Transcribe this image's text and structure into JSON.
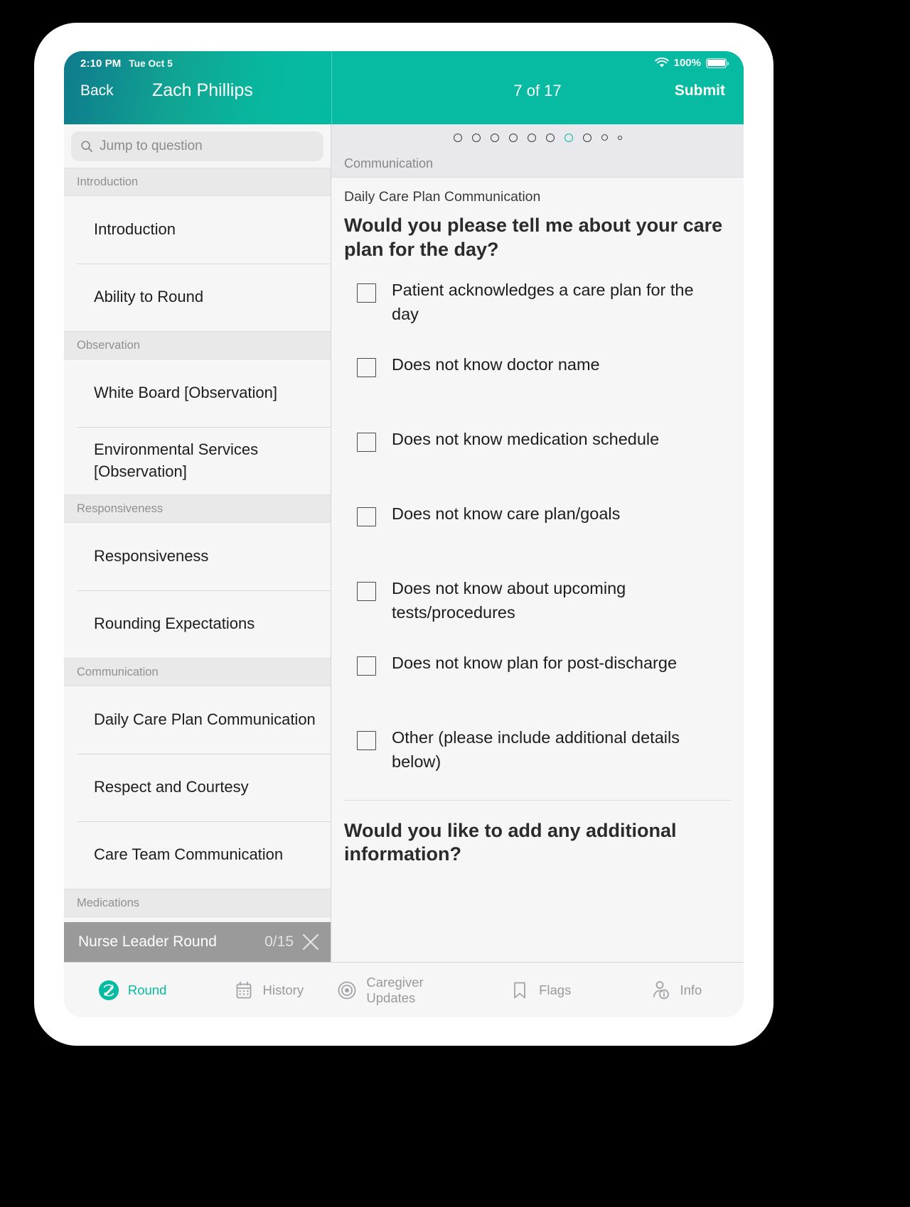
{
  "status_bar": {
    "time": "2:10 PM",
    "date": "Tue Oct 5",
    "wifi_icon": "wifi-icon",
    "battery_percent": "100%",
    "battery_icon": "battery-icon"
  },
  "nav": {
    "back_label": "Back",
    "patient_name": "Zach Phillips",
    "page_counter": "7 of 17",
    "submit_label": "Submit",
    "accent_color": "#06bba1"
  },
  "sidebar": {
    "search": {
      "placeholder": "Jump to question",
      "icon": "search-icon"
    },
    "sections": [
      {
        "header": "Introduction",
        "items": [
          "Introduction",
          "Ability to Round"
        ]
      },
      {
        "header": "Observation",
        "items": [
          "White Board [Observation]",
          "Environmental Services [Observation]"
        ]
      },
      {
        "header": "Responsiveness",
        "items": [
          "Responsiveness",
          "Rounding Expectations"
        ]
      },
      {
        "header": "Communication",
        "items": [
          "Daily Care Plan Communication",
          "Respect and Courtesy",
          "Care Team Communication"
        ]
      },
      {
        "header": "Medications",
        "items": []
      }
    ],
    "round_bar": {
      "title": "Nurse Leader Round",
      "count": "0/15",
      "close_icon": "close-icon"
    }
  },
  "pager": {
    "total_dots": 9,
    "active_index": 6
  },
  "main": {
    "section_label": "Communication",
    "question_subtitle": "Daily Care Plan Communication",
    "question_title": "Would you please tell me about your care plan for the day?",
    "options": [
      {
        "label": "Patient acknowledges a care plan for the day",
        "checked": false
      },
      {
        "label": "Does not know doctor name",
        "checked": false
      },
      {
        "label": "Does not know medication schedule",
        "checked": false
      },
      {
        "label": "Does not know care plan/goals",
        "checked": false
      },
      {
        "label": "Does not know about upcoming tests/procedures",
        "checked": false
      },
      {
        "label": "Does not know plan for post-discharge",
        "checked": false
      },
      {
        "label": "Other (please include additional details below)",
        "checked": false
      }
    ],
    "next_question_title": "Would you like to add any additional information?"
  },
  "tabbar": {
    "tabs": [
      {
        "label": "Round",
        "icon": "round-icon",
        "active": true
      },
      {
        "label": "History",
        "icon": "calendar-icon",
        "active": false
      },
      {
        "label": "Caregiver Updates",
        "icon": "target-icon",
        "active": false
      },
      {
        "label": "Flags",
        "icon": "bookmark-icon",
        "active": false
      },
      {
        "label": "Info",
        "icon": "person-info-icon",
        "active": false
      }
    ]
  }
}
